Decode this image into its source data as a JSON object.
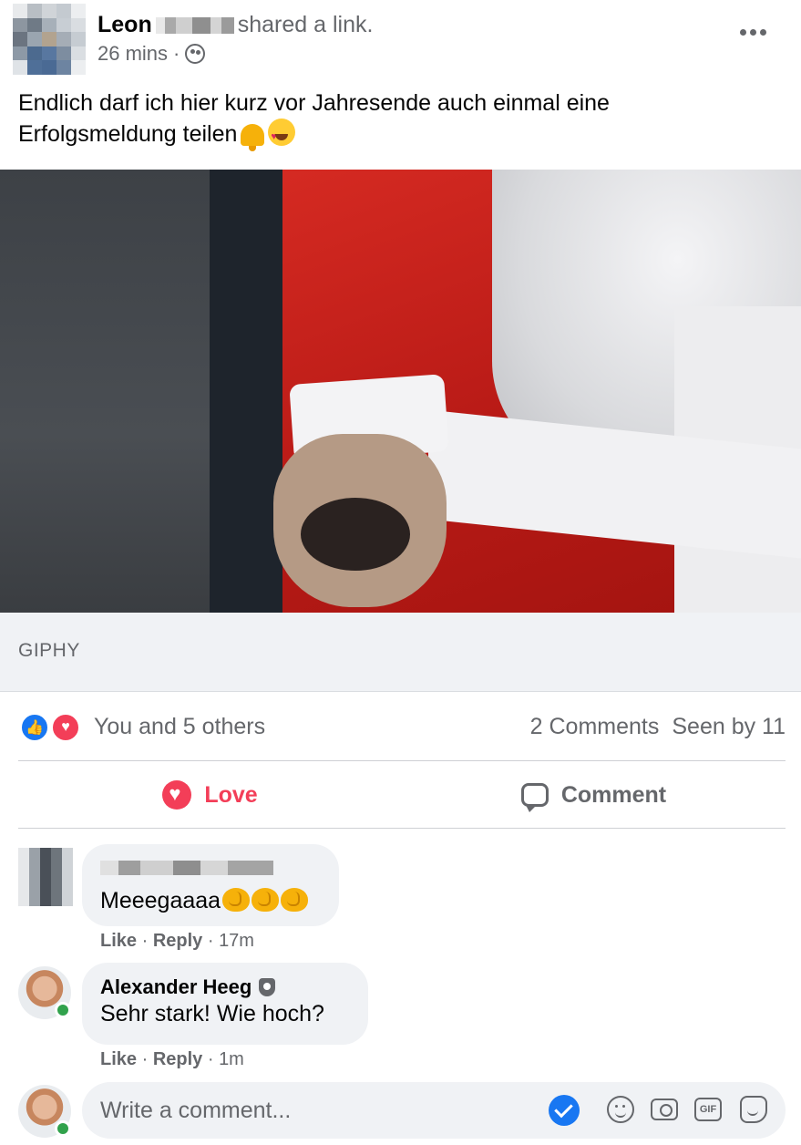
{
  "post": {
    "author_name": "Leon",
    "action": "shared a link.",
    "time": "26 mins",
    "audience_icon": "friends-icon",
    "text_line1": "Endlich darf ich hier kurz vor Jahresende auch einmal eine",
    "text_line2": "Erfolgsmeldung teilen",
    "text_emojis": [
      "bell-emoji",
      "heart-eyes-emoji"
    ],
    "more_icon": "more-icon"
  },
  "link": {
    "source": "GIPHY"
  },
  "reactions": {
    "icons": [
      "like-icon",
      "love-icon"
    ],
    "summary": "You and 5 others",
    "comments_count": "2 Comments",
    "seen_by": "Seen by 11"
  },
  "actions": {
    "love_label": "Love",
    "comment_label": "Comment"
  },
  "comments": [
    {
      "author": "",
      "text": "Meeegaaaa",
      "emojis": [
        "clapping-hands-emoji",
        "clapping-hands-emoji",
        "clapping-hands-emoji"
      ],
      "like_label": "Like",
      "reply_label": "Reply",
      "time": "17m"
    },
    {
      "author": "Alexander Heeg",
      "badge_icon": "admin-badge-icon",
      "text": "Sehr stark! Wie hoch?",
      "like_label": "Like",
      "reply_label": "Reply",
      "time": "1m",
      "online": true
    }
  ],
  "composer": {
    "placeholder": "Write a comment...",
    "tools": [
      "check-icon",
      "emoji-icon",
      "camera-icon",
      "gif-icon",
      "sticker-icon"
    ],
    "gif_label": "GIF"
  },
  "colors": {
    "accent_blue": "#1877f2",
    "love_red": "#f33e58",
    "secondary_text": "#65676b",
    "bubble_bg": "#f0f2f5"
  }
}
